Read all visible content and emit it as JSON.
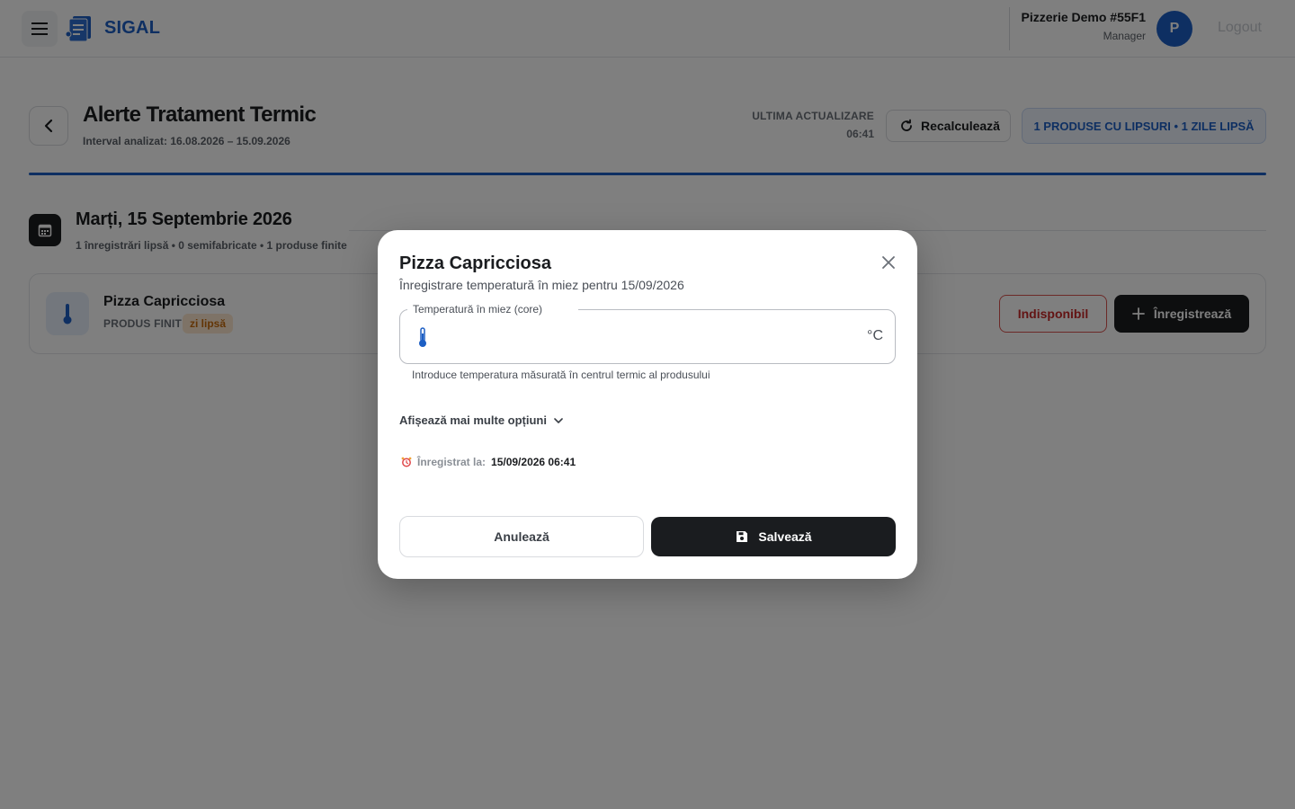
{
  "app": {
    "brand": "SIGAL",
    "menu_icon": "menu-icon",
    "logo_icon": "document-logo-icon"
  },
  "user": {
    "store_name": "Pizzerie Demo #55F1",
    "role": "Manager",
    "avatar_initial": "P",
    "logout_label": "Logout"
  },
  "page": {
    "title": "Alerte Tratament Termic",
    "interval": "Interval analizat: 16.08.2026 – 15.09.2026",
    "last_update_label": "ULTIMA ACTUALIZARE",
    "last_update_time": "06:41",
    "recalc_label": "Recalculează",
    "summary_badge": "1 PRODUSE CU LIPSURI • 1 ZILE LIPSĂ"
  },
  "day": {
    "title": "Marți, 15 Septembrie 2026",
    "summary": "1 înregistrări lipsă • 0 semifabricate • 1 produse finite",
    "products": [
      {
        "name": "Pizza Capricciosa",
        "type": "PRODUS FINIT",
        "status_chip": "zi lipsă",
        "unavailable_label": "Indisponibil",
        "register_label": "Înregistrează"
      }
    ]
  },
  "modal": {
    "title": "Pizza Capricciosa",
    "subtitle": "Înregistrare temperatură în miez pentru 15/09/2026",
    "field_label": "Temperatură în miez (core)",
    "field_value": "",
    "field_unit": "°C",
    "helper_text": "Introduce temperatura măsurată în centrul termic al produsului",
    "more_options_label": "Afișează mai multe opțiuni",
    "recorded_label": "Înregistrat la:",
    "recorded_value": "15/09/2026 06:41",
    "cancel_label": "Anulează",
    "save_label": "Salvează"
  },
  "colors": {
    "primary": "#1d5fc4",
    "dark": "#1a1c1f",
    "danger": "#c62828",
    "warning_bg": "#fde7cf",
    "warning_text": "#c66a0b",
    "overlay": "rgba(0,0,0,0.5)"
  }
}
